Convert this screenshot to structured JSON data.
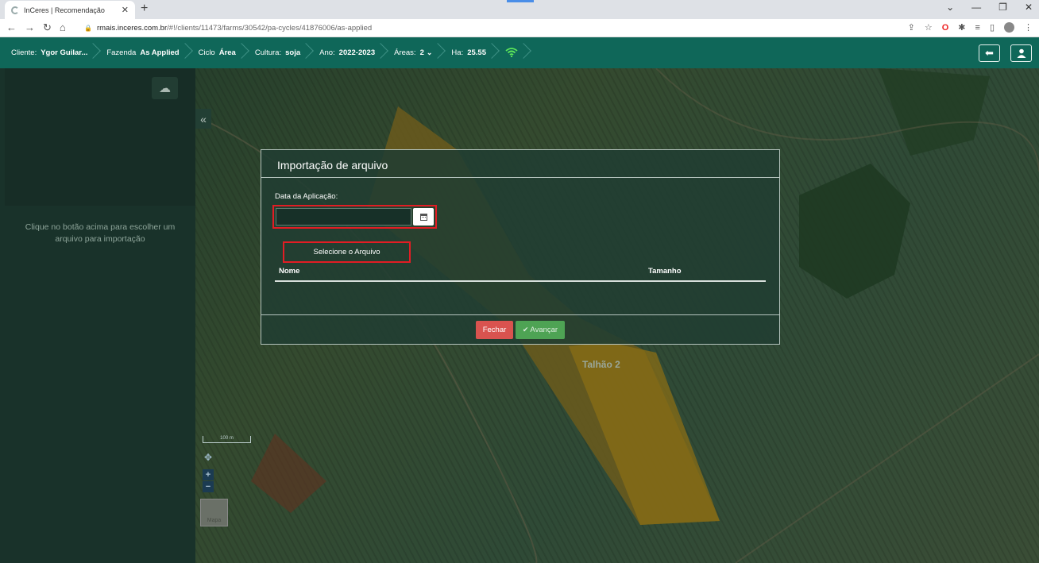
{
  "browser": {
    "tab_title": "InCeres | Recomendação",
    "tab_close": "✕",
    "new_tab": "+",
    "url_host": "rmais.inceres.com.br",
    "url_path": "/#!/clients/11473/farms/30542/pa-cycles/41876006/as-applied"
  },
  "header": {
    "crumbs": [
      {
        "label": "Cliente:",
        "value": "Ygor Guilar..."
      },
      {
        "label": "Fazenda",
        "value": "As Applied"
      },
      {
        "label": "Ciclo",
        "value": "Área"
      },
      {
        "label": "Cultura:",
        "value": "soja"
      },
      {
        "label": "Ano:",
        "value": "2022-2023"
      },
      {
        "label": "Áreas:",
        "value": "2"
      },
      {
        "label": "Ha:",
        "value": "25.55"
      }
    ],
    "accent_color": "#0f6759"
  },
  "sidebar": {
    "message_line1": "Clique no botão acima para escolher um",
    "message_line2": "arquivo para importação"
  },
  "map": {
    "field_label": "Talhão 2",
    "scale_label": "100 m",
    "basemap_label": "Mapa",
    "field_color": "#8a6e16"
  },
  "dialog": {
    "title": "Importação de arquivo",
    "date_label": "Data da Aplicação:",
    "date_value": "",
    "select_file_label": "Selecione o Arquivo",
    "col_name": "Nome",
    "col_size": "Tamanho",
    "close_label": "Fechar",
    "next_label": "Avançar",
    "close_color": "#d9534f",
    "next_color": "#4ea354",
    "highlight_color": "#e21d24"
  }
}
